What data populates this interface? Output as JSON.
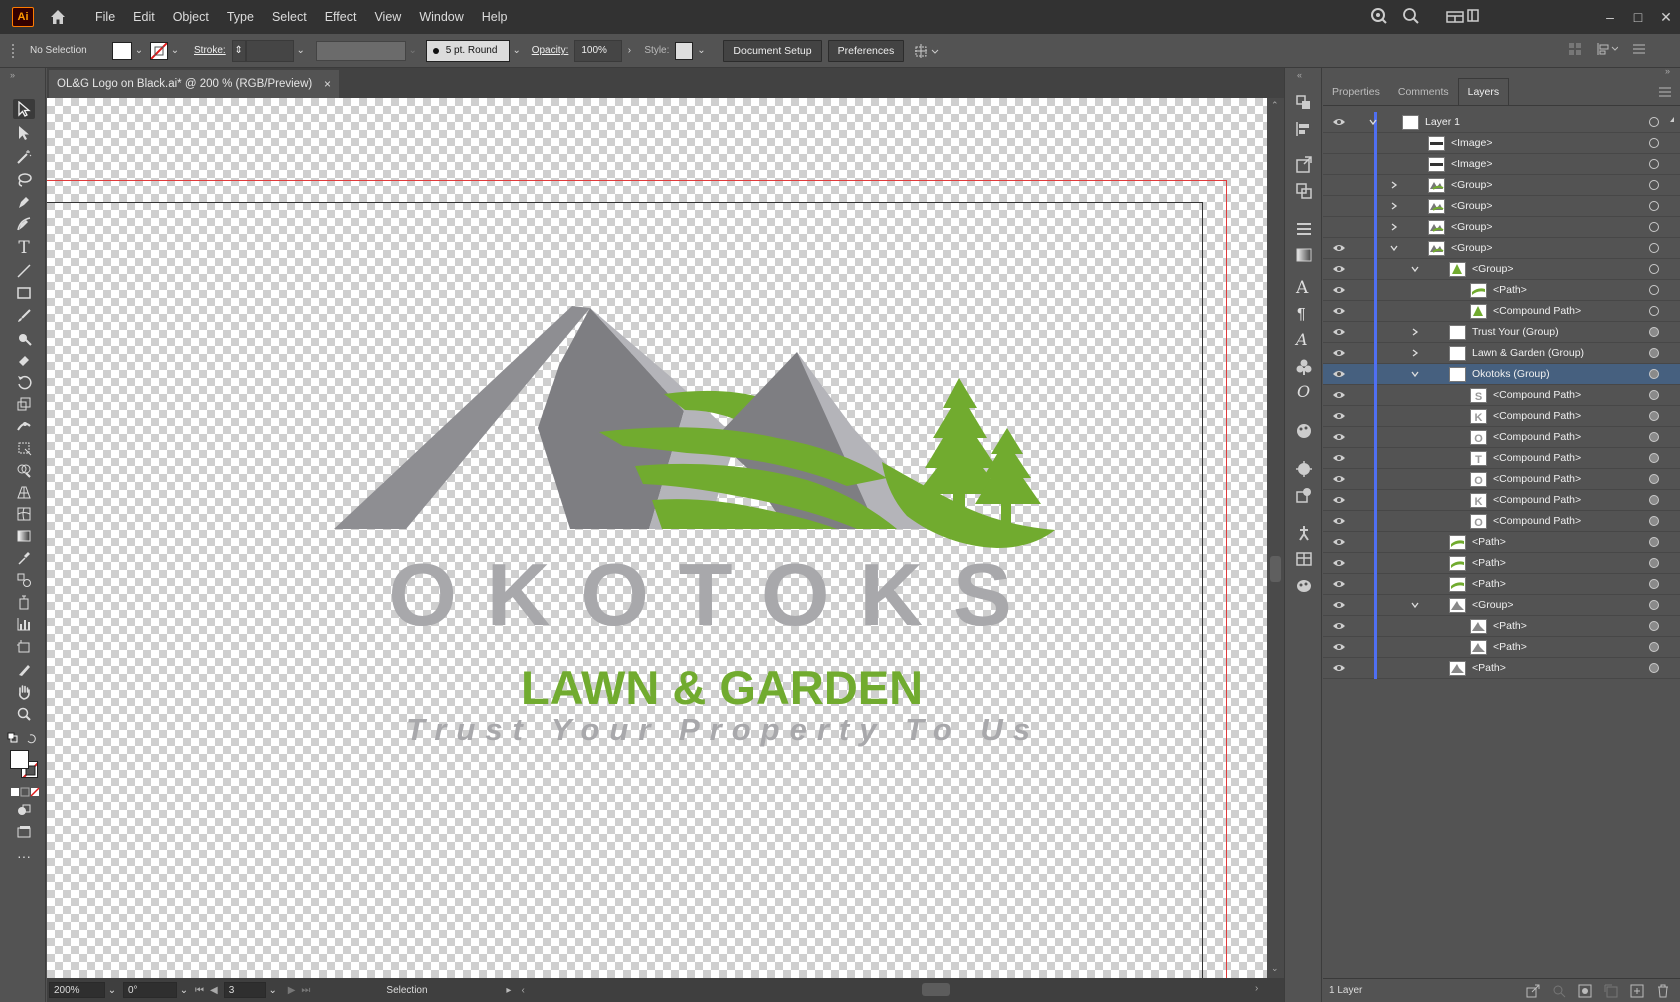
{
  "app": {
    "logo_text": "Ai",
    "menu": [
      "File",
      "Edit",
      "Object",
      "Type",
      "Select",
      "Effect",
      "View",
      "Window",
      "Help"
    ]
  },
  "control": {
    "selection": "No Selection",
    "stroke_label": "Stroke:",
    "brush": "5 pt. Round",
    "opacity_label": "Opacity:",
    "opacity_value": "100%",
    "style_label": "Style:",
    "doc_setup": "Document Setup",
    "preferences": "Preferences"
  },
  "document": {
    "tab_title": "OL&G Logo on Black.ai* @ 200 % (RGB/Preview)",
    "close": "×"
  },
  "artwork": {
    "title": "OKOTOKS",
    "subtitle": "LAWN & GARDEN",
    "tagline": "Trust Your Property To Us",
    "colors": {
      "green": "#71ab2f",
      "gray": "#8e8e92",
      "light_gray": "#b4b4b9",
      "text_gray": "#a8a8ab"
    }
  },
  "status": {
    "zoom": "200%",
    "rotate": "0°",
    "artboard": "3",
    "tool": "Selection"
  },
  "panel": {
    "tabs": [
      "Properties",
      "Comments",
      "Layers"
    ],
    "active_tab": "Layers",
    "footer_count": "1 Layer"
  },
  "layers": [
    {
      "name": "Layer 1",
      "depth": 0,
      "expand": "open",
      "eye": true,
      "thumb": "white",
      "target": "empty"
    },
    {
      "name": "<Image>",
      "depth": 1,
      "expand": "none",
      "eye": false,
      "thumb": "image",
      "target": "empty"
    },
    {
      "name": "<Image>",
      "depth": 1,
      "expand": "none",
      "eye": false,
      "thumb": "image",
      "target": "empty"
    },
    {
      "name": "<Group>",
      "depth": 1,
      "expand": "closed",
      "eye": false,
      "thumb": "logo",
      "target": "empty"
    },
    {
      "name": "<Group>",
      "depth": 1,
      "expand": "closed",
      "eye": false,
      "thumb": "logo",
      "target": "empty"
    },
    {
      "name": "<Group>",
      "depth": 1,
      "expand": "closed",
      "eye": false,
      "thumb": "logo",
      "target": "empty"
    },
    {
      "name": "<Group>",
      "depth": 1,
      "expand": "open",
      "eye": true,
      "thumb": "logo",
      "target": "empty"
    },
    {
      "name": "<Group>",
      "depth": 2,
      "expand": "open",
      "eye": true,
      "thumb": "tree",
      "target": "empty"
    },
    {
      "name": "<Path>",
      "depth": 3,
      "expand": "none",
      "eye": true,
      "thumb": "green",
      "target": "empty"
    },
    {
      "name": "<Compound Path>",
      "depth": 3,
      "expand": "none",
      "eye": true,
      "thumb": "tree",
      "target": "empty"
    },
    {
      "name": "Trust Your (Group)",
      "depth": 2,
      "expand": "closed",
      "eye": true,
      "thumb": "white",
      "target": "filled"
    },
    {
      "name": "Lawn & Garden (Group)",
      "depth": 2,
      "expand": "closed",
      "eye": true,
      "thumb": "white",
      "target": "filled"
    },
    {
      "name": "Okotoks (Group)",
      "depth": 2,
      "expand": "open",
      "eye": true,
      "thumb": "white",
      "target": "filled",
      "selected": true
    },
    {
      "name": "<Compound Path>",
      "depth": 3,
      "expand": "none",
      "eye": true,
      "thumb": "S",
      "target": "filled"
    },
    {
      "name": "<Compound Path>",
      "depth": 3,
      "expand": "none",
      "eye": true,
      "thumb": "K",
      "target": "filled"
    },
    {
      "name": "<Compound Path>",
      "depth": 3,
      "expand": "none",
      "eye": true,
      "thumb": "O",
      "target": "filled"
    },
    {
      "name": "<Compound Path>",
      "depth": 3,
      "expand": "none",
      "eye": true,
      "thumb": "T",
      "target": "filled"
    },
    {
      "name": "<Compound Path>",
      "depth": 3,
      "expand": "none",
      "eye": true,
      "thumb": "O",
      "target": "filled"
    },
    {
      "name": "<Compound Path>",
      "depth": 3,
      "expand": "none",
      "eye": true,
      "thumb": "K",
      "target": "filled"
    },
    {
      "name": "<Compound Path>",
      "depth": 3,
      "expand": "none",
      "eye": true,
      "thumb": "O",
      "target": "filled"
    },
    {
      "name": "<Path>",
      "depth": 2,
      "expand": "none",
      "eye": true,
      "thumb": "green",
      "target": "filled"
    },
    {
      "name": "<Path>",
      "depth": 2,
      "expand": "none",
      "eye": true,
      "thumb": "green",
      "target": "filled"
    },
    {
      "name": "<Path>",
      "depth": 2,
      "expand": "none",
      "eye": true,
      "thumb": "green",
      "target": "filled"
    },
    {
      "name": "<Group>",
      "depth": 2,
      "expand": "open",
      "eye": true,
      "thumb": "mount",
      "target": "filled"
    },
    {
      "name": "<Path>",
      "depth": 3,
      "expand": "none",
      "eye": true,
      "thumb": "mount",
      "target": "filled"
    },
    {
      "name": "<Path>",
      "depth": 3,
      "expand": "none",
      "eye": true,
      "thumb": "mount",
      "target": "filled"
    },
    {
      "name": "<Path>",
      "depth": 2,
      "expand": "none",
      "eye": true,
      "thumb": "mount",
      "target": "filled"
    }
  ]
}
